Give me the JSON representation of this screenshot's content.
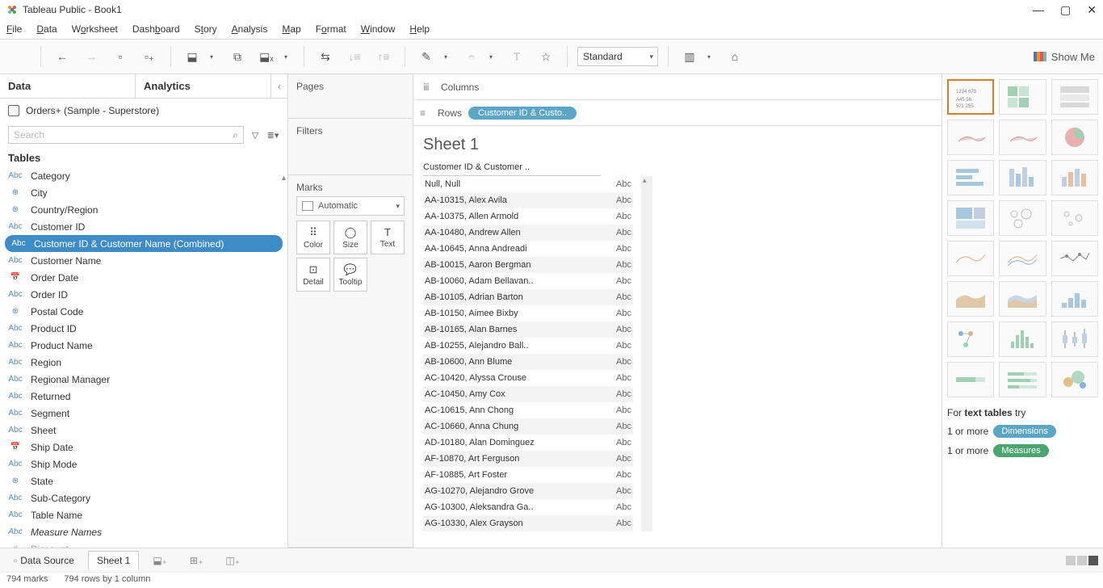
{
  "window": {
    "title": "Tableau Public - Book1"
  },
  "menu": [
    "File",
    "Data",
    "Worksheet",
    "Dashboard",
    "Story",
    "Analysis",
    "Map",
    "Format",
    "Window",
    "Help"
  ],
  "toolbar": {
    "fit": "Standard",
    "showme": "Show Me"
  },
  "data_pane": {
    "tabs": [
      "Data",
      "Analytics"
    ],
    "datasource": "Orders+ (Sample - Superstore)",
    "search_placeholder": "Search",
    "tables_label": "Tables",
    "fields": [
      {
        "icon": "Abc",
        "label": "Category"
      },
      {
        "icon": "globe",
        "label": "City"
      },
      {
        "icon": "globe",
        "label": "Country/Region"
      },
      {
        "icon": "Abc",
        "label": "Customer ID"
      },
      {
        "icon": "Abc",
        "label": "Customer ID & Customer Name (Combined)",
        "selected": true
      },
      {
        "icon": "Abc",
        "label": "Customer Name"
      },
      {
        "icon": "date",
        "label": "Order Date"
      },
      {
        "icon": "Abc",
        "label": "Order ID"
      },
      {
        "icon": "globe",
        "label": "Postal Code"
      },
      {
        "icon": "Abc",
        "label": "Product ID"
      },
      {
        "icon": "Abc",
        "label": "Product Name"
      },
      {
        "icon": "Abc",
        "label": "Region"
      },
      {
        "icon": "Abc",
        "label": "Regional Manager"
      },
      {
        "icon": "Abc",
        "label": "Returned"
      },
      {
        "icon": "Abc",
        "label": "Segment"
      },
      {
        "icon": "Abc",
        "label": "Sheet"
      },
      {
        "icon": "date",
        "label": "Ship Date"
      },
      {
        "icon": "Abc",
        "label": "Ship Mode"
      },
      {
        "icon": "globe",
        "label": "State"
      },
      {
        "icon": "Abc",
        "label": "Sub-Category"
      },
      {
        "icon": "Abc",
        "label": "Table Name"
      },
      {
        "icon": "Abc",
        "label": "Measure Names",
        "italic": true
      },
      {
        "icon": "#",
        "label": "Discount",
        "cut": true
      }
    ]
  },
  "shelves": {
    "pages": "Pages",
    "filters": "Filters",
    "marks": "Marks",
    "marks_type": "Automatic",
    "mark_buttons": [
      {
        "label": "Color"
      },
      {
        "label": "Size"
      },
      {
        "label": "Text"
      },
      {
        "label": "Detail"
      },
      {
        "label": "Tooltip"
      }
    ],
    "columns": "Columns",
    "rows": "Rows",
    "rows_pill": "Customer ID & Custo.."
  },
  "sheet": {
    "title": "Sheet 1",
    "header": "Customer ID & Customer ..",
    "rows": [
      "Null, Null",
      "AA-10315, Alex Avila",
      "AA-10375, Allen Armold",
      "AA-10480, Andrew Allen",
      "AA-10645, Anna Andreadi",
      "AB-10015, Aaron Bergman",
      "AB-10060, Adam Bellavan..",
      "AB-10105, Adrian Barton",
      "AB-10150, Aimee Bixby",
      "AB-10165, Alan Barnes",
      "AB-10255, Alejandro Ball..",
      "AB-10600, Ann Blume",
      "AC-10420, Alyssa Crouse",
      "AC-10450, Amy Cox",
      "AC-10615, Ann Chong",
      "AC-10660, Anna Chung",
      "AD-10180, Alan Dominguez",
      "AF-10870, Art Ferguson",
      "AF-10885, Art Foster",
      "AG-10270, Alejandro Grove",
      "AG-10300, Aleksandra Ga..",
      "AG-10330, Alex Grayson"
    ],
    "abc": "Abc"
  },
  "showme": {
    "hint_prefix": "For ",
    "hint_bold": "text tables",
    "hint_suffix": " try",
    "req1_prefix": "1 or more ",
    "req1_pill": "Dimensions",
    "req2_prefix": "1 or more ",
    "req2_pill": "Measures"
  },
  "bottom": {
    "datasource_tab": "Data Source",
    "sheet_tab": "Sheet 1"
  },
  "status": {
    "marks": "794 marks",
    "dims": "794 rows by 1 column"
  }
}
